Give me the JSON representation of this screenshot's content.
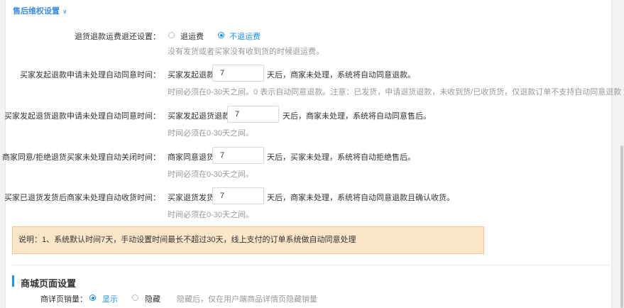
{
  "section_after_sales": {
    "title": "售后维权设置",
    "chevron_icon": "chevron-down-icon"
  },
  "return_shipping": {
    "label": "退货退款运费退还设置：",
    "options": [
      "退运费",
      "不退运费"
    ],
    "selected": "不退运费",
    "hint": "没有发货或者买家没有收到货的时候退运费。"
  },
  "rows": [
    {
      "label": "买家发起退款申请未处理自动同意时间：",
      "prefix": "买家发起退款",
      "value": "7",
      "suffix": "天后，商家未处理，系统将自动同意退款。",
      "hint": "时间必须在0-30天之间。0 表示自动同意退款。注意：已发货，申请退货退款，未收到货/已收货货，仅退款订单不支持自动同意退款"
    },
    {
      "label": "买家发起退货退款申请未处理自动同意时间：",
      "prefix": "买家发起退货退款",
      "value": "7",
      "suffix": "天后，商家未处理，系统将自动同意售后。",
      "hint": "时间必须在0-30天之间。"
    },
    {
      "label": "商家同意/拒绝退货买家未处理自动关闭时间：",
      "prefix": "商家同意退货",
      "value": "7",
      "suffix": "天后，买家未处理，系统将自动拒绝售后。",
      "hint": "时间必须在0-30天之间。"
    },
    {
      "label": "买家已退货发货后商家未处理自动收货时间：",
      "prefix": "买家退货发货",
      "value": "7",
      "suffix": "天后，商家未处理，系统将自动同意退款且确认收货。",
      "hint": "时间必须在0-30天之间。"
    }
  ],
  "notice": "说明：1、系统默认时间7天，手动设置时间最长不超过30天，线上支付的订单系统做自动同意处理",
  "section_mall": {
    "title": "商城页面设置",
    "sales_label": "商详页销量：",
    "options": [
      "显示",
      "隐藏"
    ],
    "selected": "显示",
    "hint": "隐藏后，仅在用户端商品详情页隐藏销量"
  },
  "colors": {
    "accent": "#1890ff",
    "notice_bg": "#fde5c8",
    "hint": "#999999"
  }
}
